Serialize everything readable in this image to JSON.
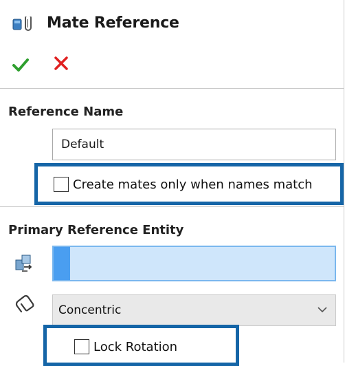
{
  "panel": {
    "title": "Mate Reference",
    "title_icon": "mate-reference-icon",
    "ok_icon": "checkmark-icon",
    "cancel_icon": "close-icon",
    "colors": {
      "ok": "#2e9f2e",
      "cancel": "#e02020",
      "highlight": "#1565a7",
      "selection": "#cfe6fb"
    }
  },
  "reference_name": {
    "heading": "Reference Name",
    "value": "Default",
    "create_mates_checkbox": {
      "label": "Create mates only when names match",
      "checked": false
    }
  },
  "primary_reference": {
    "heading": "Primary Reference Entity",
    "entity_icon": "reference-entity-icon",
    "selection_value": "",
    "mate_type_icon": "paperclip-icon",
    "mate_type": "Concentric",
    "dropdown_icon": "chevron-down-icon",
    "lock_rotation_checkbox": {
      "label": "Lock Rotation",
      "checked": false
    }
  }
}
